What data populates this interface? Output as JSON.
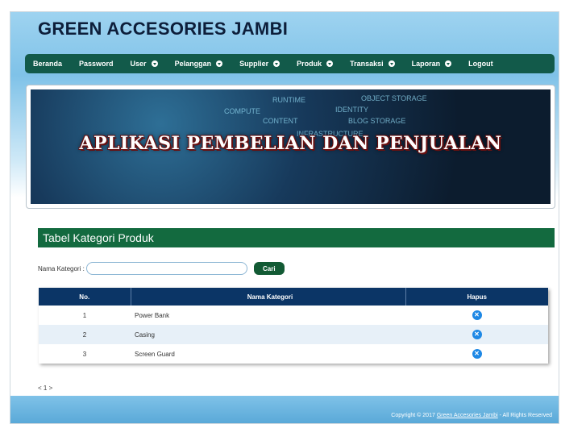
{
  "app": {
    "title": "GREEN ACCESORIES JAMBI"
  },
  "nav": {
    "items": [
      {
        "label": "Beranda",
        "dropdown": false
      },
      {
        "label": "Password",
        "dropdown": false
      },
      {
        "label": "User",
        "dropdown": true
      },
      {
        "label": "Pelanggan",
        "dropdown": true
      },
      {
        "label": "Supplier",
        "dropdown": true
      },
      {
        "label": "Produk",
        "dropdown": true
      },
      {
        "label": "Transaksi",
        "dropdown": true
      },
      {
        "label": "Laporan",
        "dropdown": true
      },
      {
        "label": "Logout",
        "dropdown": false
      }
    ]
  },
  "banner": {
    "title": "APLIKASI PEMBELIAN DAN PENJUALAN",
    "words": [
      "RUNTIME",
      "IDENTITY",
      "OBJECT STORAGE",
      "CONTENT",
      "BLOG STORAGE",
      "INFRASTRUCTURE",
      "COMPUTE"
    ]
  },
  "section": {
    "title": "Tabel Kategori Produk"
  },
  "search": {
    "label": "Nama Kategori :",
    "value": "",
    "placeholder": "",
    "button": "Cari"
  },
  "table": {
    "headers": [
      "No.",
      "Nama Kategori",
      "Hapus"
    ],
    "rows": [
      {
        "no": "1",
        "name": "Power Bank"
      },
      {
        "no": "2",
        "name": "Casing"
      },
      {
        "no": "3",
        "name": "Screen Guard"
      }
    ]
  },
  "pager": {
    "text": "< 1 >"
  },
  "footer": {
    "prefix": "Copyright © 2017 ",
    "link": "Green Accesories Jambi",
    "suffix": " - All Rights Reserved"
  },
  "colors": {
    "header_band": "#7fc2e8",
    "navbar": "#125a4a",
    "section_header": "#136a3f",
    "table_header": "#0b3566",
    "delete_icon": "#1e88e5"
  },
  "icons": {
    "dropdown": "chevron-down-circle-icon",
    "delete": "close-circle-icon"
  }
}
